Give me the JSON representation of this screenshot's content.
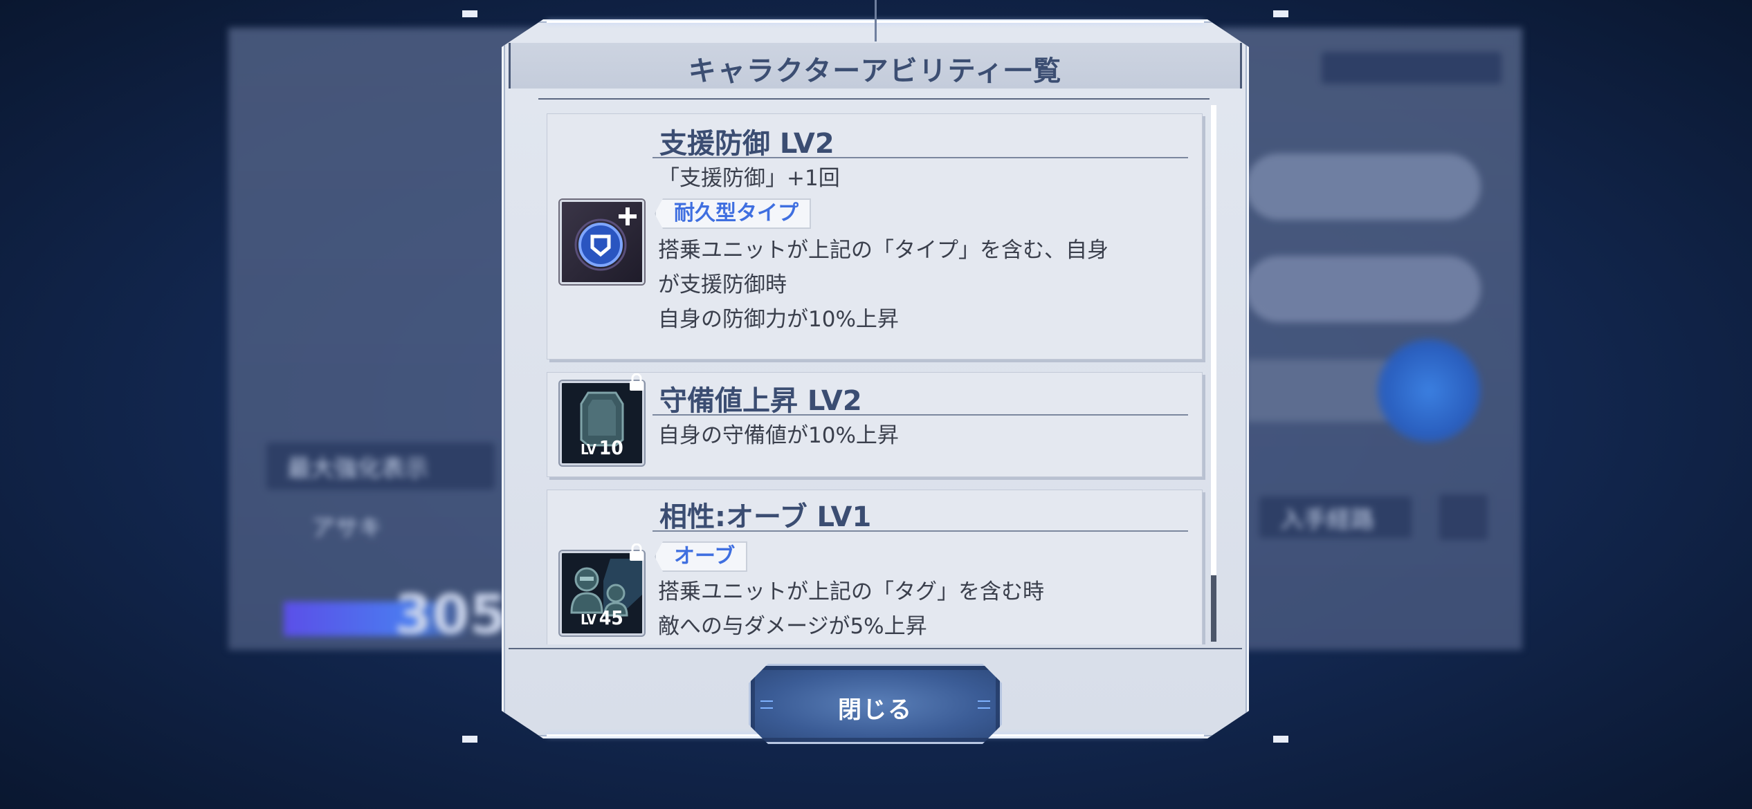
{
  "background": {
    "left_label": "最大強化表示",
    "left_name": "アサキ",
    "left_number": "305",
    "right_label": "入手経路"
  },
  "modal": {
    "title": "キャラクターアビリティ一覧",
    "abilities": [
      {
        "title": "支援防御 LV2",
        "line1": "「支援防御」+1回",
        "tag": "耐久型タイプ",
        "line2": "搭乗ユニットが上記の「タイプ」を含む、自身",
        "line3": "が支援防御時",
        "line4": "自身の防御力が10%上昇",
        "icon": "shield-plus-icon"
      },
      {
        "title": "守備値上昇 LV2",
        "line1": "自身の守備値が10%上昇",
        "unlock_level": "10",
        "lv_prefix": "LV",
        "icon": "armor-plate-icon"
      },
      {
        "title": "相性:オーブ LV1",
        "tag": "オーブ",
        "line1": "搭乗ユニットが上記の「タグ」を含む時",
        "line2": "敵への与ダメージが5%上昇",
        "unlock_level": "45",
        "lv_prefix": "LV",
        "icon": "pilot-mech-icon"
      }
    ],
    "close_label": "閉じる"
  },
  "colors": {
    "accent": "#3f6fe0",
    "title_text": "#3b4d72",
    "panel_bg": "#e4e8f0"
  }
}
